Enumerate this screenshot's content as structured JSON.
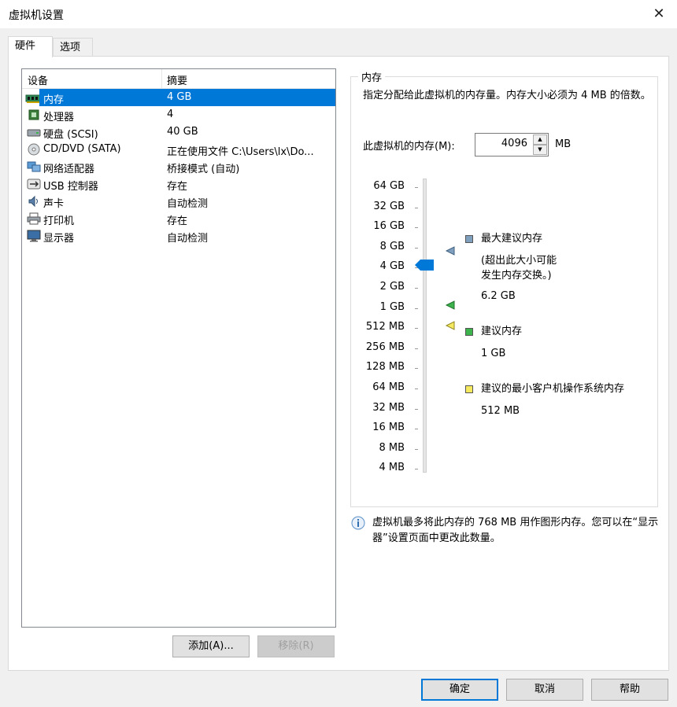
{
  "window": {
    "title": "虚拟机设置",
    "close_glyph": "✕"
  },
  "tabs": [
    {
      "label": "硬件",
      "active": true
    },
    {
      "label": "选项",
      "active": false
    }
  ],
  "devices": {
    "col_device": "设备",
    "col_summary": "摘要",
    "rows": [
      {
        "name": "内存",
        "summary": "4 GB",
        "icon": "memory-icon",
        "selected": true
      },
      {
        "name": "处理器",
        "summary": "4",
        "icon": "cpu-icon"
      },
      {
        "name": "硬盘 (SCSI)",
        "summary": "40 GB",
        "icon": "harddisk-icon"
      },
      {
        "name": "CD/DVD (SATA)",
        "summary": "正在使用文件 C:\\Users\\lx\\Do...",
        "icon": "cdrom-icon"
      },
      {
        "name": "网络适配器",
        "summary": "桥接模式 (自动)",
        "icon": "network-icon"
      },
      {
        "name": "USB 控制器",
        "summary": "存在",
        "icon": "usb-icon"
      },
      {
        "name": "声卡",
        "summary": "自动检测",
        "icon": "sound-icon"
      },
      {
        "name": "打印机",
        "summary": "存在",
        "icon": "printer-icon"
      },
      {
        "name": "显示器",
        "summary": "自动检测",
        "icon": "display-icon"
      }
    ],
    "add_label": "添加(A)...",
    "remove_label": "移除(R)"
  },
  "memory": {
    "group_title": "内存",
    "description": "指定分配给此虚拟机的内存量。内存大小必须为 4 MB 的倍数。",
    "field_label": "此虚拟机的内存(M):",
    "value": "4096",
    "unit": "MB",
    "scale": [
      "64 GB",
      "32 GB",
      "16 GB",
      "8 GB",
      "4 GB",
      "2 GB",
      "1 GB",
      "512 MB",
      "256 MB",
      "128 MB",
      "64 MB",
      "32 MB",
      "16 MB",
      "8 MB",
      "4 MB"
    ],
    "current_level": "4 GB",
    "legend": {
      "max_title": "最大建议内存",
      "max_note": "(超出此大小可能发生内存交换。)",
      "max_note_line1": "(超出此大小可能",
      "max_note_line2": "发生内存交换。)",
      "max_value": "6.2 GB",
      "rec_title": "建议内存",
      "rec_value": "1 GB",
      "min_title": "建议的最小客户机操作系统内存",
      "min_value": "512 MB"
    },
    "colors": {
      "max": "#7f9fbf",
      "rec": "#3cb44b",
      "min": "#f5e960",
      "thumb": "#0078d7"
    }
  },
  "info": {
    "text": "虚拟机最多将此内存的 768 MB 用作图形内存。您可以在“显示器”设置页面中更改此数量。"
  },
  "footer": {
    "ok": "确定",
    "cancel": "取消",
    "help": "帮助"
  }
}
